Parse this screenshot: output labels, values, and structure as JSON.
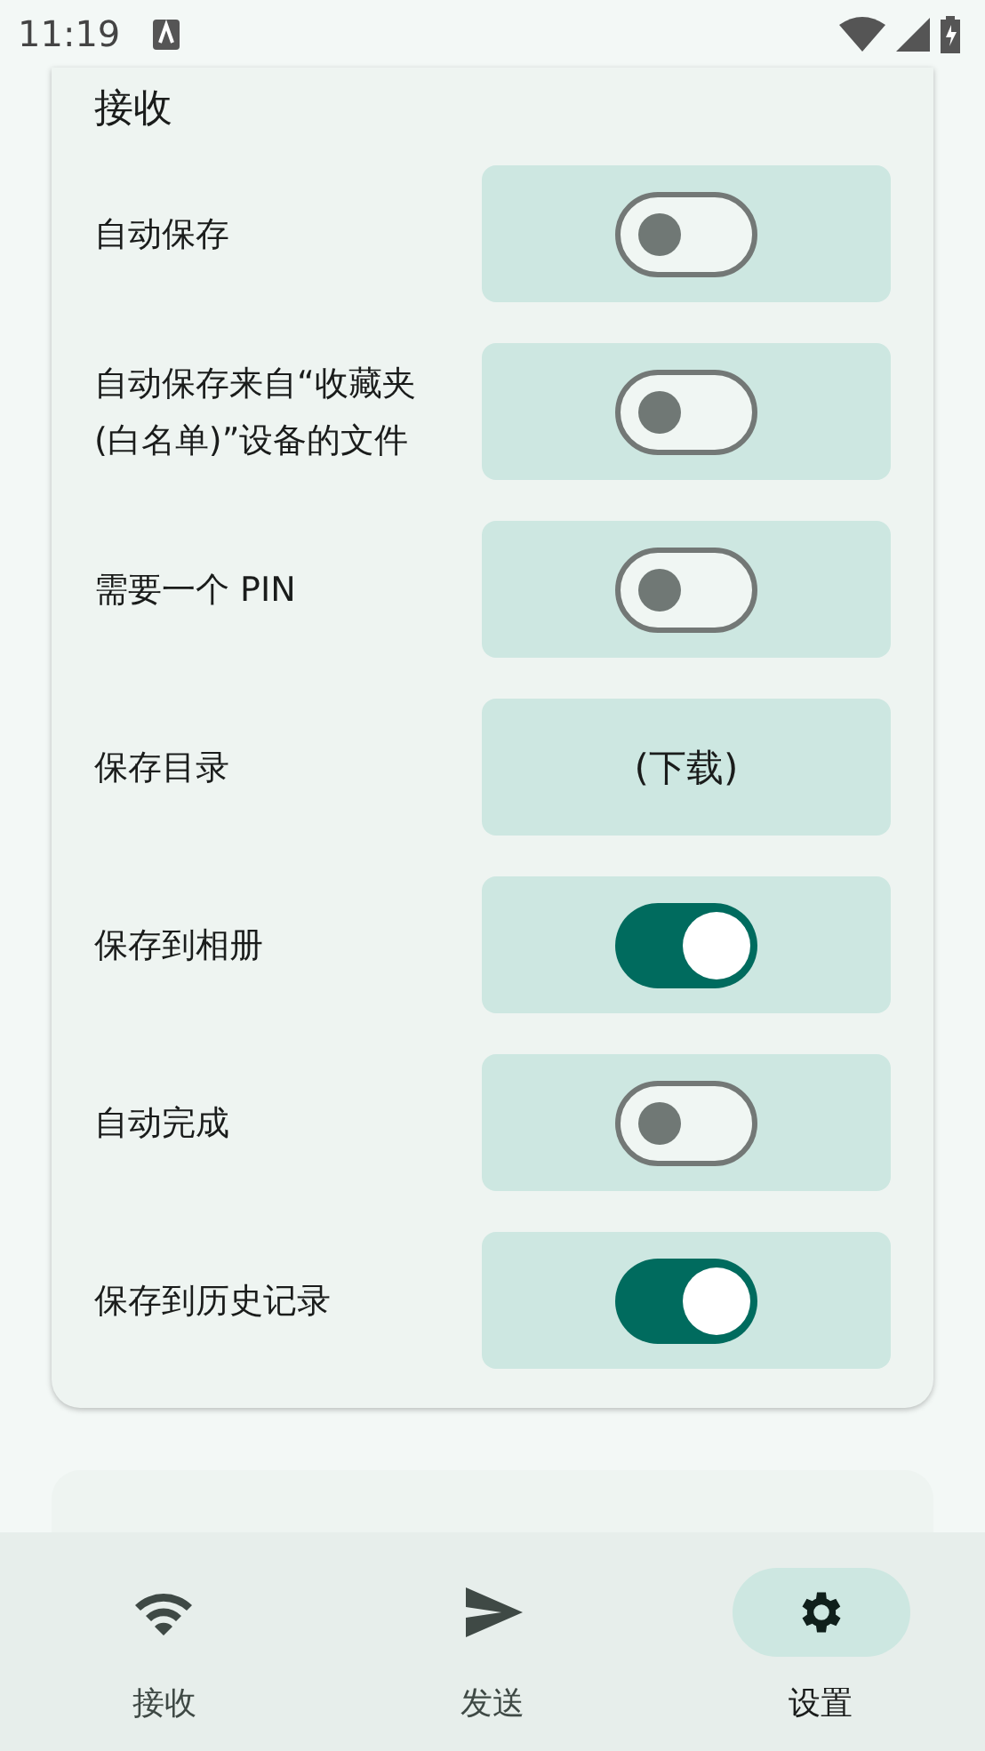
{
  "status_bar": {
    "time": "11:19"
  },
  "section": {
    "title": "接收",
    "rows": [
      {
        "label": "自动保存",
        "kind": "toggle",
        "on": false
      },
      {
        "label": "自动保存来自“收藏夹(白名单)”设备的文件",
        "kind": "toggle",
        "on": false
      },
      {
        "label": "需要一个 PIN",
        "kind": "toggle",
        "on": false
      },
      {
        "label": "保存目录",
        "kind": "value",
        "value": "(下载)"
      },
      {
        "label": "保存到相册",
        "kind": "toggle",
        "on": true
      },
      {
        "label": "自动完成",
        "kind": "toggle",
        "on": false
      },
      {
        "label": "保存到历史记录",
        "kind": "toggle",
        "on": true
      }
    ]
  },
  "nav": [
    {
      "label": "接收",
      "selected": false
    },
    {
      "label": "发送",
      "selected": false
    },
    {
      "label": "设置",
      "selected": true
    }
  ]
}
